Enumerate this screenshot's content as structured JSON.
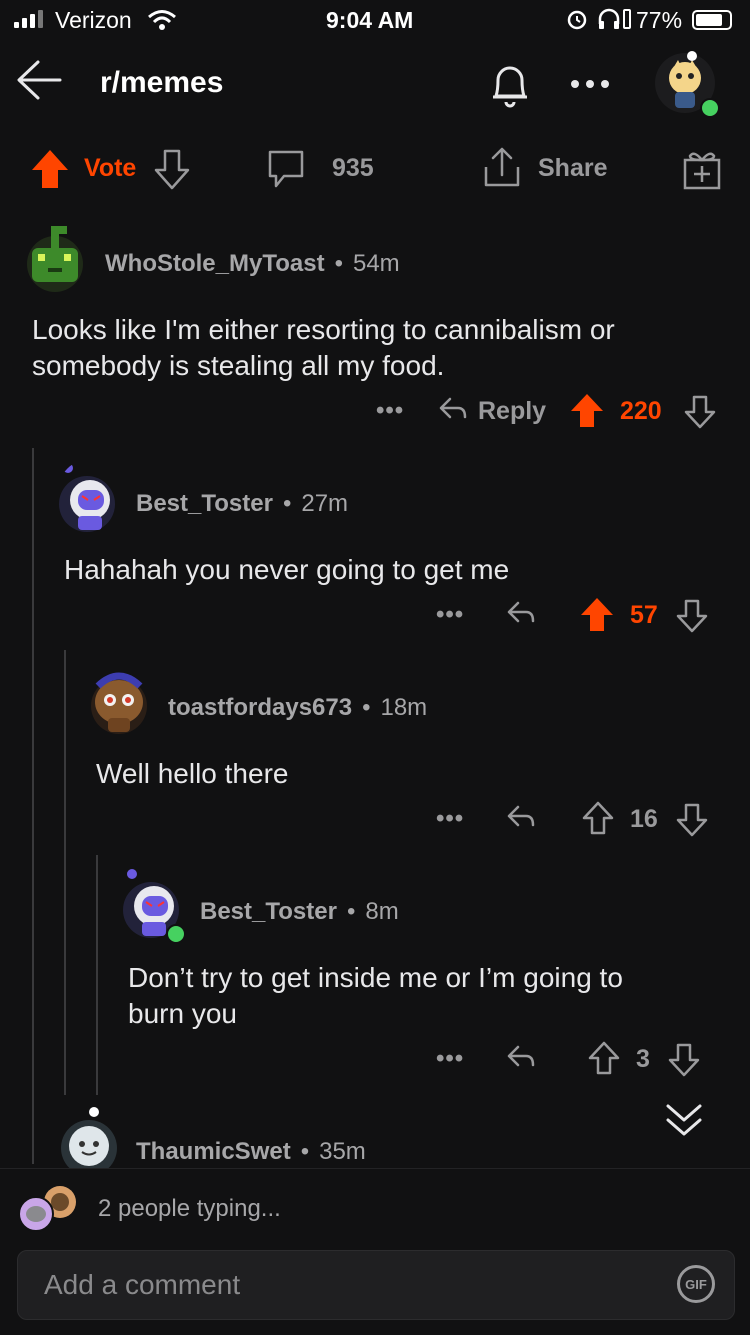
{
  "status_bar": {
    "carrier": "Verizon",
    "time": "9:04 AM",
    "battery": "77%"
  },
  "header": {
    "subreddit": "r/memes"
  },
  "action_bar": {
    "vote_label": "Vote",
    "comment_count": "935",
    "share_label": "Share"
  },
  "comments": [
    {
      "author": "WhoStole_MyToast",
      "time": "54m",
      "body_lines": [
        "Looks like I'm either resorting to cannibalism or",
        "somebody is stealing all my food."
      ],
      "reply_label": "Reply",
      "score": "220",
      "upvoted": true
    },
    {
      "author": "Best_Toster",
      "time": "27m",
      "body_lines": [
        "Hahahah you never going to get me"
      ],
      "score": "57",
      "upvoted": true
    },
    {
      "author": "toastfordays673",
      "time": "18m",
      "body_lines": [
        "Well hello there"
      ],
      "score": "16",
      "upvoted": false
    },
    {
      "author": "Best_Toster",
      "time": "8m",
      "body_lines": [
        "Don’t try to get inside me or I’m going to",
        "burn you"
      ],
      "score": "3",
      "upvoted": false
    },
    {
      "author": "ThaumicSwet",
      "time": "35m"
    }
  ],
  "typing_indicator": "2 people typing...",
  "composer": {
    "placeholder": "Add a comment",
    "gif_label": "GIF"
  },
  "colors": {
    "upvote": "#ff4500",
    "muted": "#9a9a9c",
    "online": "#46d160"
  },
  "separator": "•",
  "more_dots": "•••"
}
